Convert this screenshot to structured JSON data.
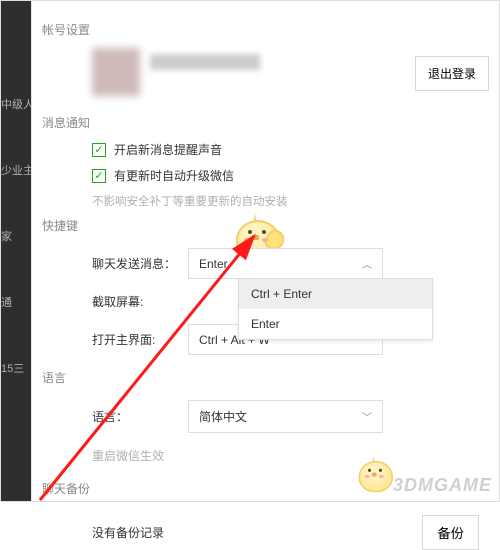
{
  "sidebar": {
    "items": [
      "中级人",
      "少业主",
      "家",
      "通",
      "15三"
    ]
  },
  "sections": {
    "account": "帐号设置",
    "notify": "消息通知",
    "shortcut": "快捷键",
    "language": "语言",
    "backup": "聊天备份"
  },
  "logout": "退出登录",
  "notify": {
    "opt1": "开启新消息提醒声音",
    "opt2": "有更新时自动升级微信",
    "hint": "不影响安全补丁等重要更新的自动安装"
  },
  "shortcut": {
    "send_label": "聊天发送消息：",
    "send_value": "Enter",
    "dropdown": {
      "opt1": "Ctrl + Enter",
      "opt2": "Enter"
    },
    "capture_label": "截取屏幕:",
    "open_label": "打开主界面:",
    "open_value": "Ctrl + Alt + W"
  },
  "language": {
    "label": "语言：",
    "value": "简体中文",
    "note": "重启微信生效"
  },
  "backup": {
    "empty": "没有备份记录",
    "button": "备份"
  },
  "watermark": "3DMGAME"
}
